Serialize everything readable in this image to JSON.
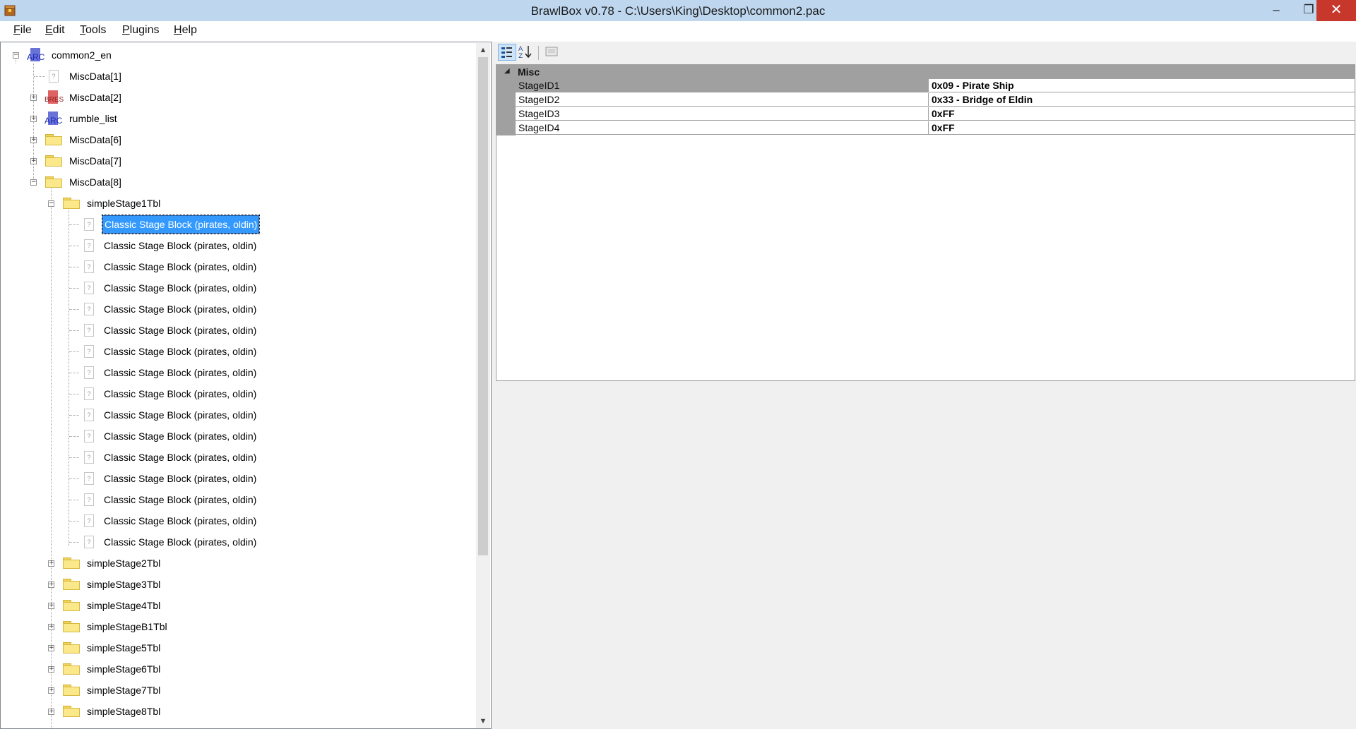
{
  "window": {
    "title": "BrawlBox v0.78 - C:\\Users\\King\\Desktop\\common2.pac",
    "minimize_glyph": "–",
    "maximize_glyph": "❐",
    "close_glyph": "✕"
  },
  "menu": {
    "items": [
      "File",
      "Edit",
      "Tools",
      "Plugins",
      "Help"
    ]
  },
  "tree": {
    "root": {
      "label": "common2_en",
      "icon_text": "ARC"
    },
    "level1": [
      {
        "label": "MiscData[1]",
        "icon": "file"
      },
      {
        "label": "MiscData[2]",
        "icon": "bres",
        "icon_text": "BRES"
      },
      {
        "label": "rumble_list",
        "icon": "arc",
        "icon_text": "ARC"
      },
      {
        "label": "MiscData[6]",
        "icon": "folder"
      },
      {
        "label": "MiscData[7]",
        "icon": "folder"
      },
      {
        "label": "MiscData[8]",
        "icon": "folder"
      }
    ],
    "expanded_folder": "simpleStage1Tbl",
    "file_icon_glyph": "?",
    "stage_blocks": [
      "Classic Stage Block (pirates, oldin)",
      "Classic Stage Block (pirates, oldin)",
      "Classic Stage Block (pirates, oldin)",
      "Classic Stage Block (pirates, oldin)",
      "Classic Stage Block (pirates, oldin)",
      "Classic Stage Block (pirates, oldin)",
      "Classic Stage Block (pirates, oldin)",
      "Classic Stage Block (pirates, oldin)",
      "Classic Stage Block (pirates, oldin)",
      "Classic Stage Block (pirates, oldin)",
      "Classic Stage Block (pirates, oldin)",
      "Classic Stage Block (pirates, oldin)",
      "Classic Stage Block (pirates, oldin)",
      "Classic Stage Block (pirates, oldin)",
      "Classic Stage Block (pirates, oldin)",
      "Classic Stage Block (pirates, oldin)"
    ],
    "selected_index": 0,
    "collapsed_folders": [
      "simpleStage2Tbl",
      "simpleStage3Tbl",
      "simpleStage4Tbl",
      "simpleStageB1Tbl",
      "simpleStage5Tbl",
      "simpleStage6Tbl",
      "simpleStage7Tbl",
      "simpleStage8Tbl"
    ]
  },
  "scrollbar": {
    "up_glyph": "▲",
    "down_glyph": "▼"
  },
  "property_grid": {
    "category": "Misc",
    "category_glyph": "◢",
    "properties": [
      {
        "name": "StageID1",
        "value": "0x09 - Pirate Ship"
      },
      {
        "name": "StageID2",
        "value": "0x33 - Bridge of Eldin"
      },
      {
        "name": "StageID3",
        "value": "0xFF"
      },
      {
        "name": "StageID4",
        "value": "0xFF"
      }
    ],
    "selected_property": 0
  },
  "colors": {
    "titlebar": "#bed7ef",
    "close_button": "#c7372b",
    "selection": "#3399ff",
    "grid_line": "#a0a0a0"
  }
}
